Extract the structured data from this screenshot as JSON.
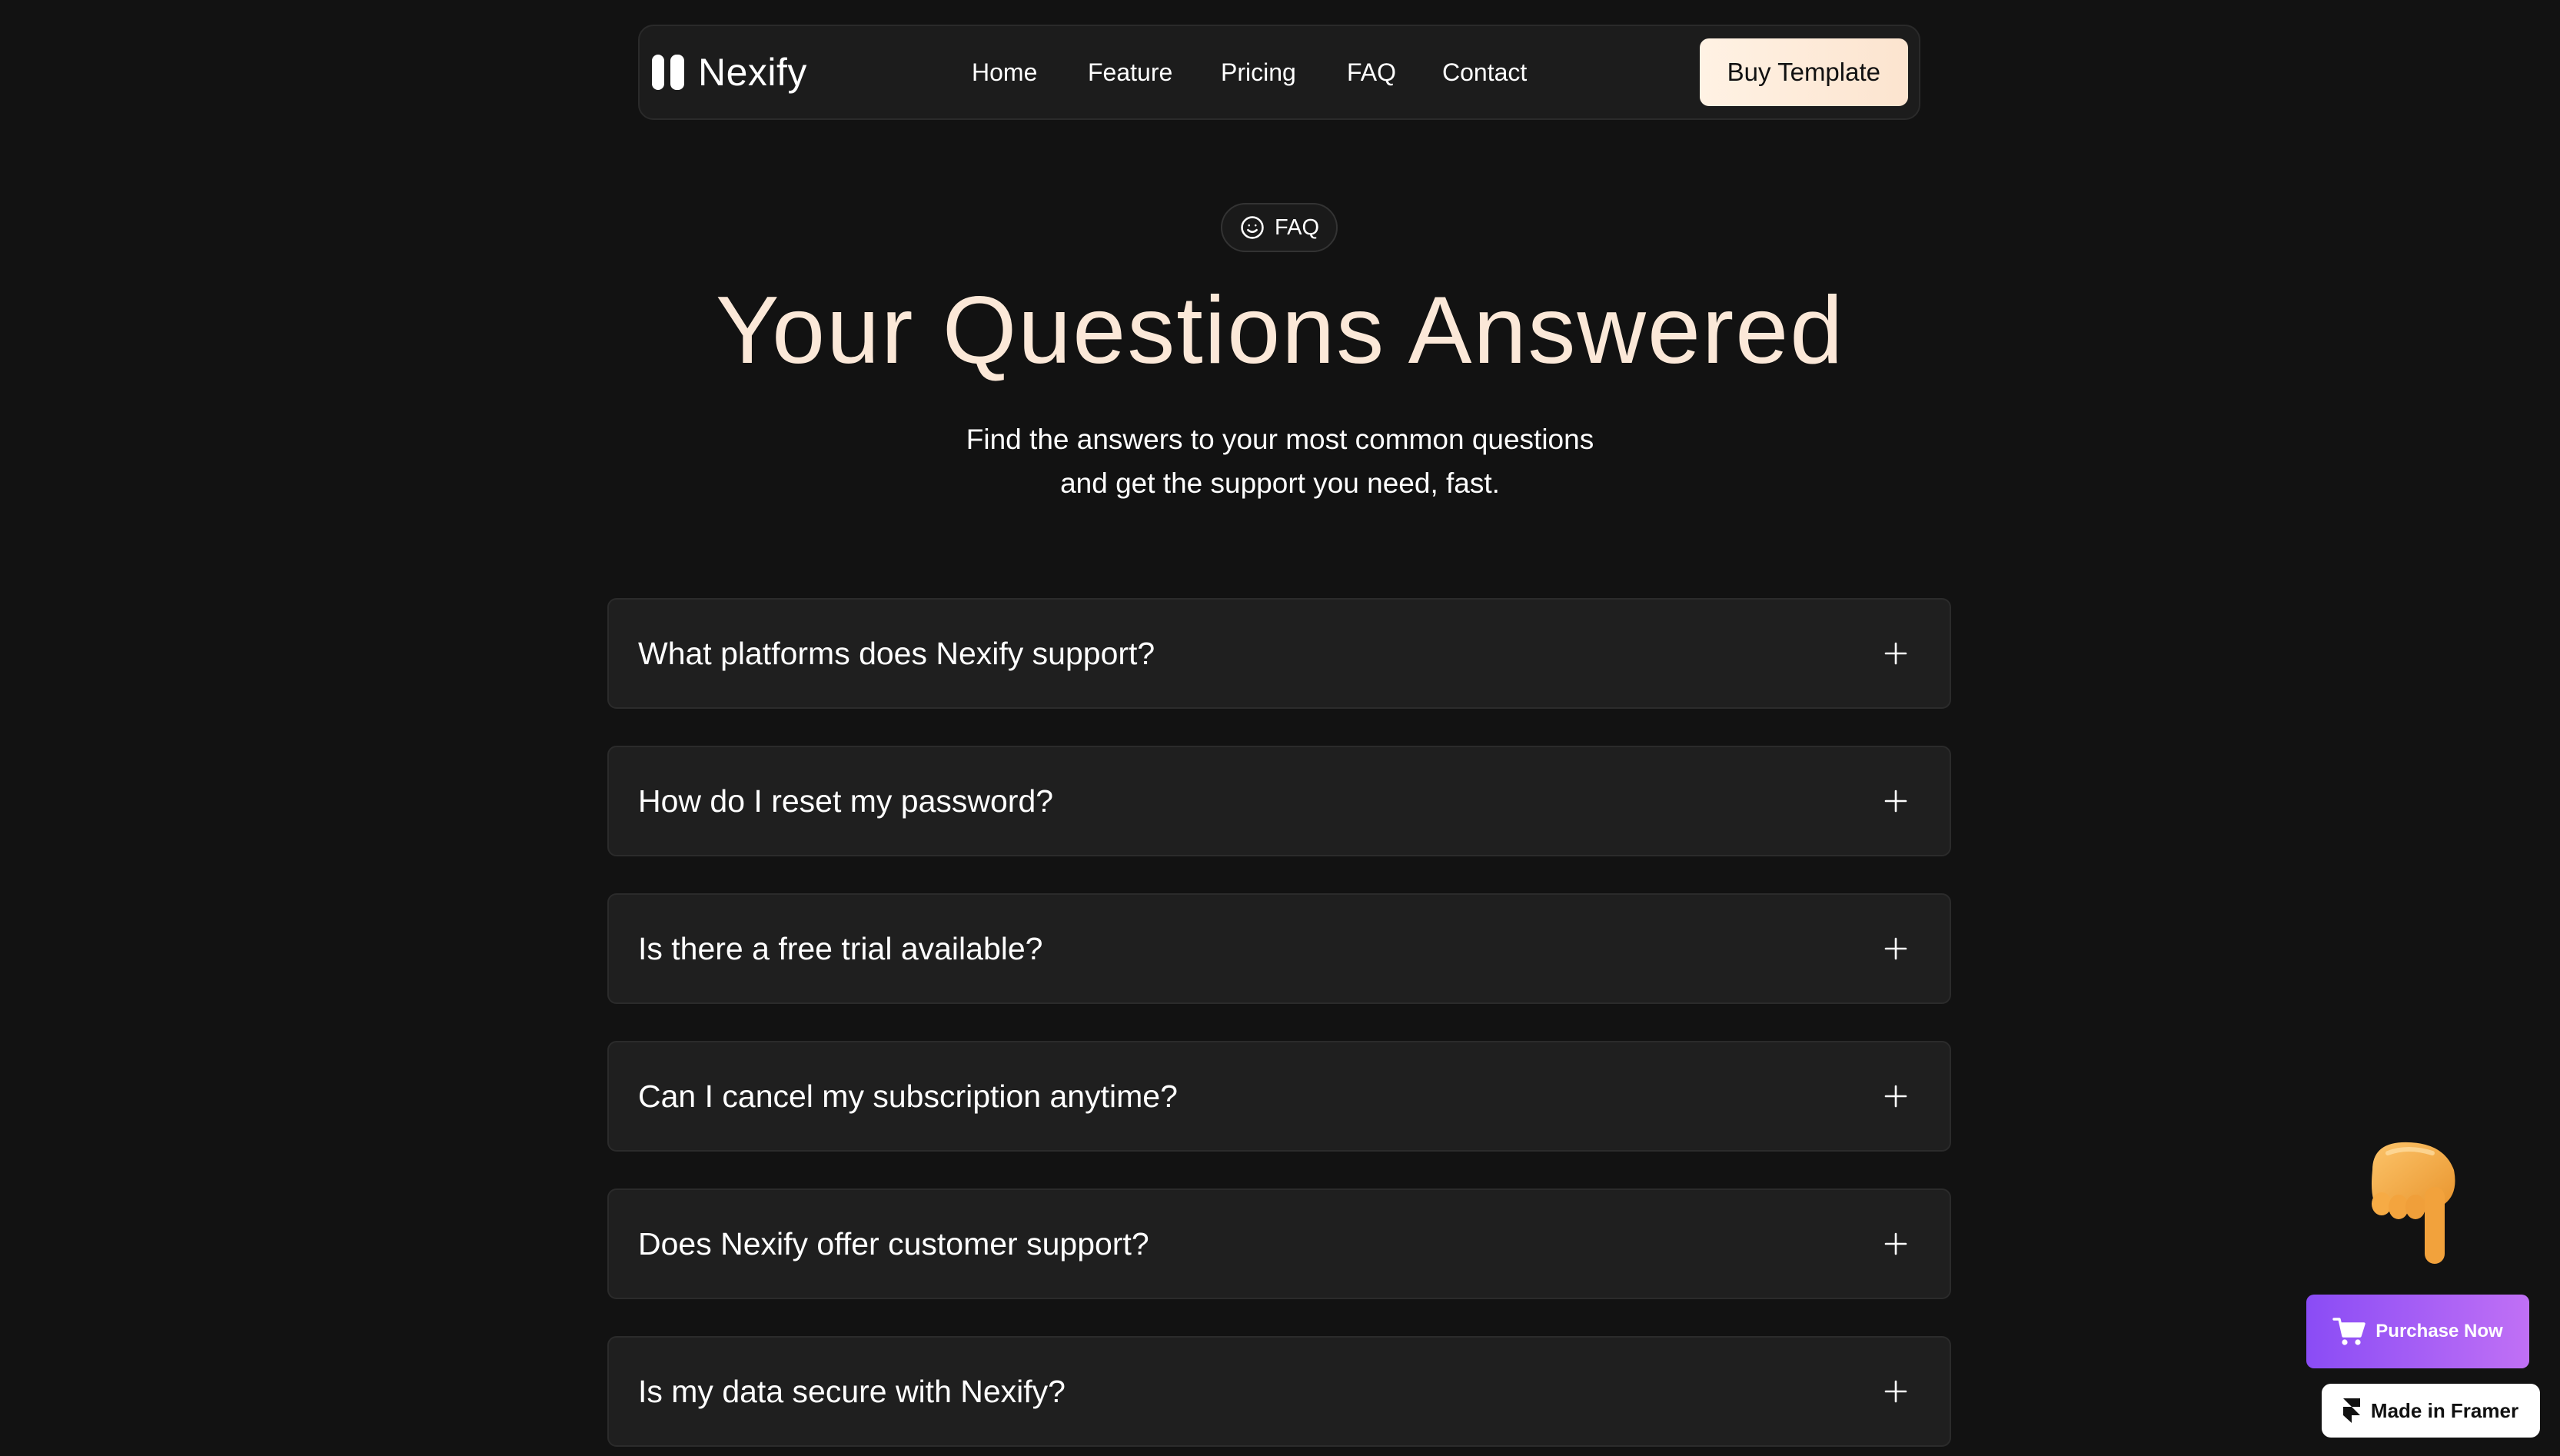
{
  "nav": {
    "brand": "Nexify",
    "links": [
      "Home",
      "Feature",
      "Pricing",
      "FAQ",
      "Contact"
    ],
    "cta": "Buy Template"
  },
  "hero": {
    "badge": "FAQ",
    "title": "Your Questions Answered",
    "subtitle_line1": "Find the answers to your most common questions",
    "subtitle_line2": "and get the support you need, fast."
  },
  "faq": {
    "items": [
      "What platforms does Nexify support?",
      "How do I reset my password?",
      "Is there a free trial available?",
      "Can I cancel my subscription anytime?",
      "Does Nexify offer customer support?",
      "Is my data secure with Nexify?"
    ]
  },
  "floating": {
    "purchase_label": "Purchase Now",
    "framer_label": "Made in Framer",
    "hand_icon": "pointing-down-hand-icon"
  },
  "colors": {
    "background": "#121212",
    "card": "#1f1f1f",
    "title": "#fbe8d8",
    "cta_gradient": [
      "#fff2e4",
      "#fce4cf"
    ],
    "purchase_gradient": [
      "#8a4cf5",
      "#c070f5"
    ]
  }
}
